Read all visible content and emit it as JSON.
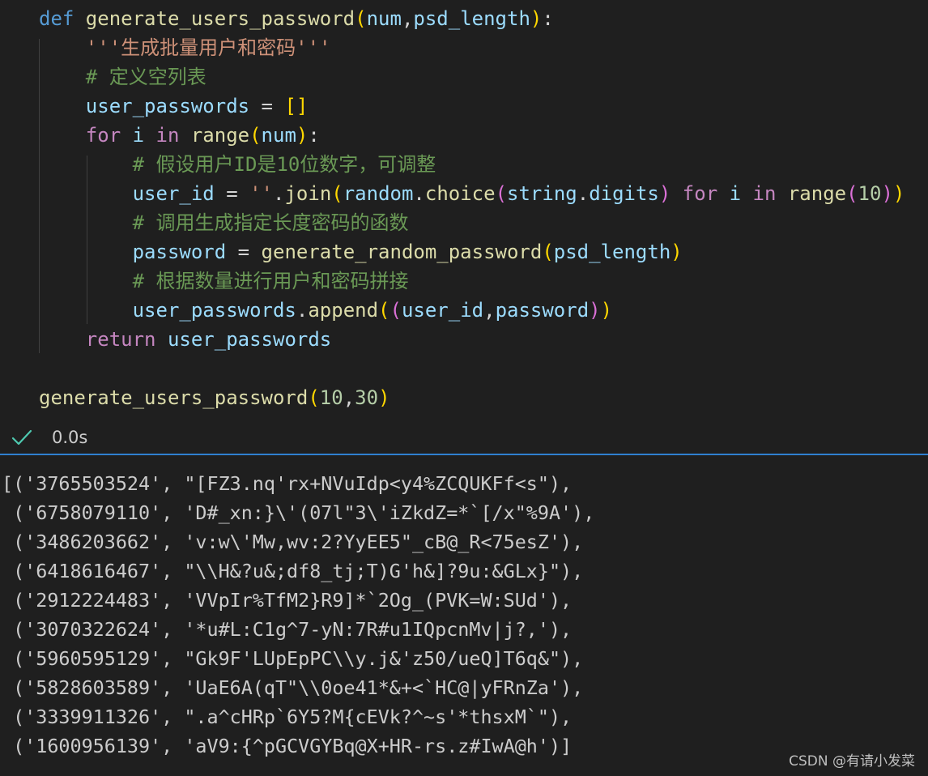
{
  "code": {
    "lines": [
      [
        [
          "t-kw",
          "def "
        ],
        [
          "t-fn",
          "generate_users_password"
        ],
        [
          "t-p1",
          "("
        ],
        [
          "t-var",
          "num"
        ],
        [
          "t-op",
          ","
        ],
        [
          "t-var",
          "psd_length"
        ],
        [
          "t-p1",
          ")"
        ],
        [
          "t-op",
          ":"
        ]
      ],
      [
        [
          "t-plain",
          "    "
        ],
        [
          "t-str",
          "'''生成批量用户和密码'''"
        ]
      ],
      [
        [
          "t-plain",
          "    "
        ],
        [
          "t-com",
          "# 定义空列表"
        ]
      ],
      [
        [
          "t-plain",
          "    "
        ],
        [
          "t-var",
          "user_passwords"
        ],
        [
          "t-op",
          " = "
        ],
        [
          "t-p1",
          "[]"
        ]
      ],
      [
        [
          "t-plain",
          "    "
        ],
        [
          "t-ctl",
          "for "
        ],
        [
          "t-var",
          "i"
        ],
        [
          "t-ctl",
          " in "
        ],
        [
          "t-fn",
          "range"
        ],
        [
          "t-p1",
          "("
        ],
        [
          "t-var",
          "num"
        ],
        [
          "t-p1",
          ")"
        ],
        [
          "t-op",
          ":"
        ]
      ],
      [
        [
          "t-plain",
          "        "
        ],
        [
          "t-com",
          "# 假设用户ID是10位数字，可调整"
        ]
      ],
      [
        [
          "t-plain",
          "        "
        ],
        [
          "t-var",
          "user_id"
        ],
        [
          "t-op",
          " = "
        ],
        [
          "t-str",
          "''"
        ],
        [
          "t-op",
          "."
        ],
        [
          "t-fn",
          "join"
        ],
        [
          "t-p1",
          "("
        ],
        [
          "t-var",
          "random"
        ],
        [
          "t-op",
          "."
        ],
        [
          "t-fn",
          "choice"
        ],
        [
          "t-p2",
          "("
        ],
        [
          "t-var",
          "string"
        ],
        [
          "t-op",
          "."
        ],
        [
          "t-var",
          "digits"
        ],
        [
          "t-p2",
          ")"
        ],
        [
          "t-ctl",
          " for "
        ],
        [
          "t-var",
          "i"
        ],
        [
          "t-ctl",
          " in "
        ],
        [
          "t-fn",
          "range"
        ],
        [
          "t-p2",
          "("
        ],
        [
          "t-num",
          "10"
        ],
        [
          "t-p2",
          ")"
        ],
        [
          "t-p1",
          ")"
        ]
      ],
      [
        [
          "t-plain",
          "        "
        ],
        [
          "t-com",
          "# 调用生成指定长度密码的函数"
        ]
      ],
      [
        [
          "t-plain",
          "        "
        ],
        [
          "t-var",
          "password"
        ],
        [
          "t-op",
          " = "
        ],
        [
          "t-fn",
          "generate_random_password"
        ],
        [
          "t-p1",
          "("
        ],
        [
          "t-var",
          "psd_length"
        ],
        [
          "t-p1",
          ")"
        ]
      ],
      [
        [
          "t-plain",
          "        "
        ],
        [
          "t-com",
          "# 根据数量进行用户和密码拼接"
        ]
      ],
      [
        [
          "t-plain",
          "        "
        ],
        [
          "t-var",
          "user_passwords"
        ],
        [
          "t-op",
          "."
        ],
        [
          "t-fn",
          "append"
        ],
        [
          "t-p1",
          "("
        ],
        [
          "t-p2",
          "("
        ],
        [
          "t-var",
          "user_id"
        ],
        [
          "t-op",
          ","
        ],
        [
          "t-var",
          "password"
        ],
        [
          "t-p2",
          ")"
        ],
        [
          "t-p1",
          ")"
        ]
      ],
      [
        [
          "t-plain",
          "    "
        ],
        [
          "t-ctl",
          "return "
        ],
        [
          "t-var",
          "user_passwords"
        ]
      ],
      [],
      [
        [
          "t-fn",
          "generate_users_password"
        ],
        [
          "t-p1",
          "("
        ],
        [
          "t-num",
          "10"
        ],
        [
          "t-op",
          ","
        ],
        [
          "t-num",
          "30"
        ],
        [
          "t-p1",
          ")"
        ]
      ]
    ]
  },
  "status": {
    "icon": "check-icon",
    "icon_color": "#4ec9b0",
    "time": "0.0s"
  },
  "output": {
    "lines": [
      "[('3765503524', \"[FZ3.nq'rx+NVuIdp<y4%ZCQUKFf<s\"),",
      " ('6758079110', 'D#_xn:}\\'(07l\"3\\'iZkdZ=*`[/x\"%9A'),",
      " ('3486203662', 'v:w\\'Mw,wv:2?YyEE5\"_cB@_R<75esZ'),",
      " ('6418616467', \"\\\\H&?u&;df8_tj;T)G'h&]?9u:&GLx}\"),",
      " ('2912224483', 'VVpIr%TfM2}R9]*`2Og_(PVK=W:SUd'),",
      " ('3070322624', '*u#L:C1g^7-yN:7R#u1IQpcnMv|j?,'),",
      " ('5960595129', \"Gk9F'LUpEpPC\\\\y.j&'z50/ueQ]T6q&\"),",
      " ('5828603589', 'UaE6A(qT\"\\\\0oe41*&+<`HC@|yFRnZa'),",
      " ('3339911326', \".a^cHRp`6Y5?M{cEVk?^~s'*thsxM`\"),",
      " ('1600956139', 'aV9:{^pGCVGYBq@X+HR-rs.z#IwA@h')]"
    ]
  },
  "watermark": "CSDN @有请小发菜"
}
